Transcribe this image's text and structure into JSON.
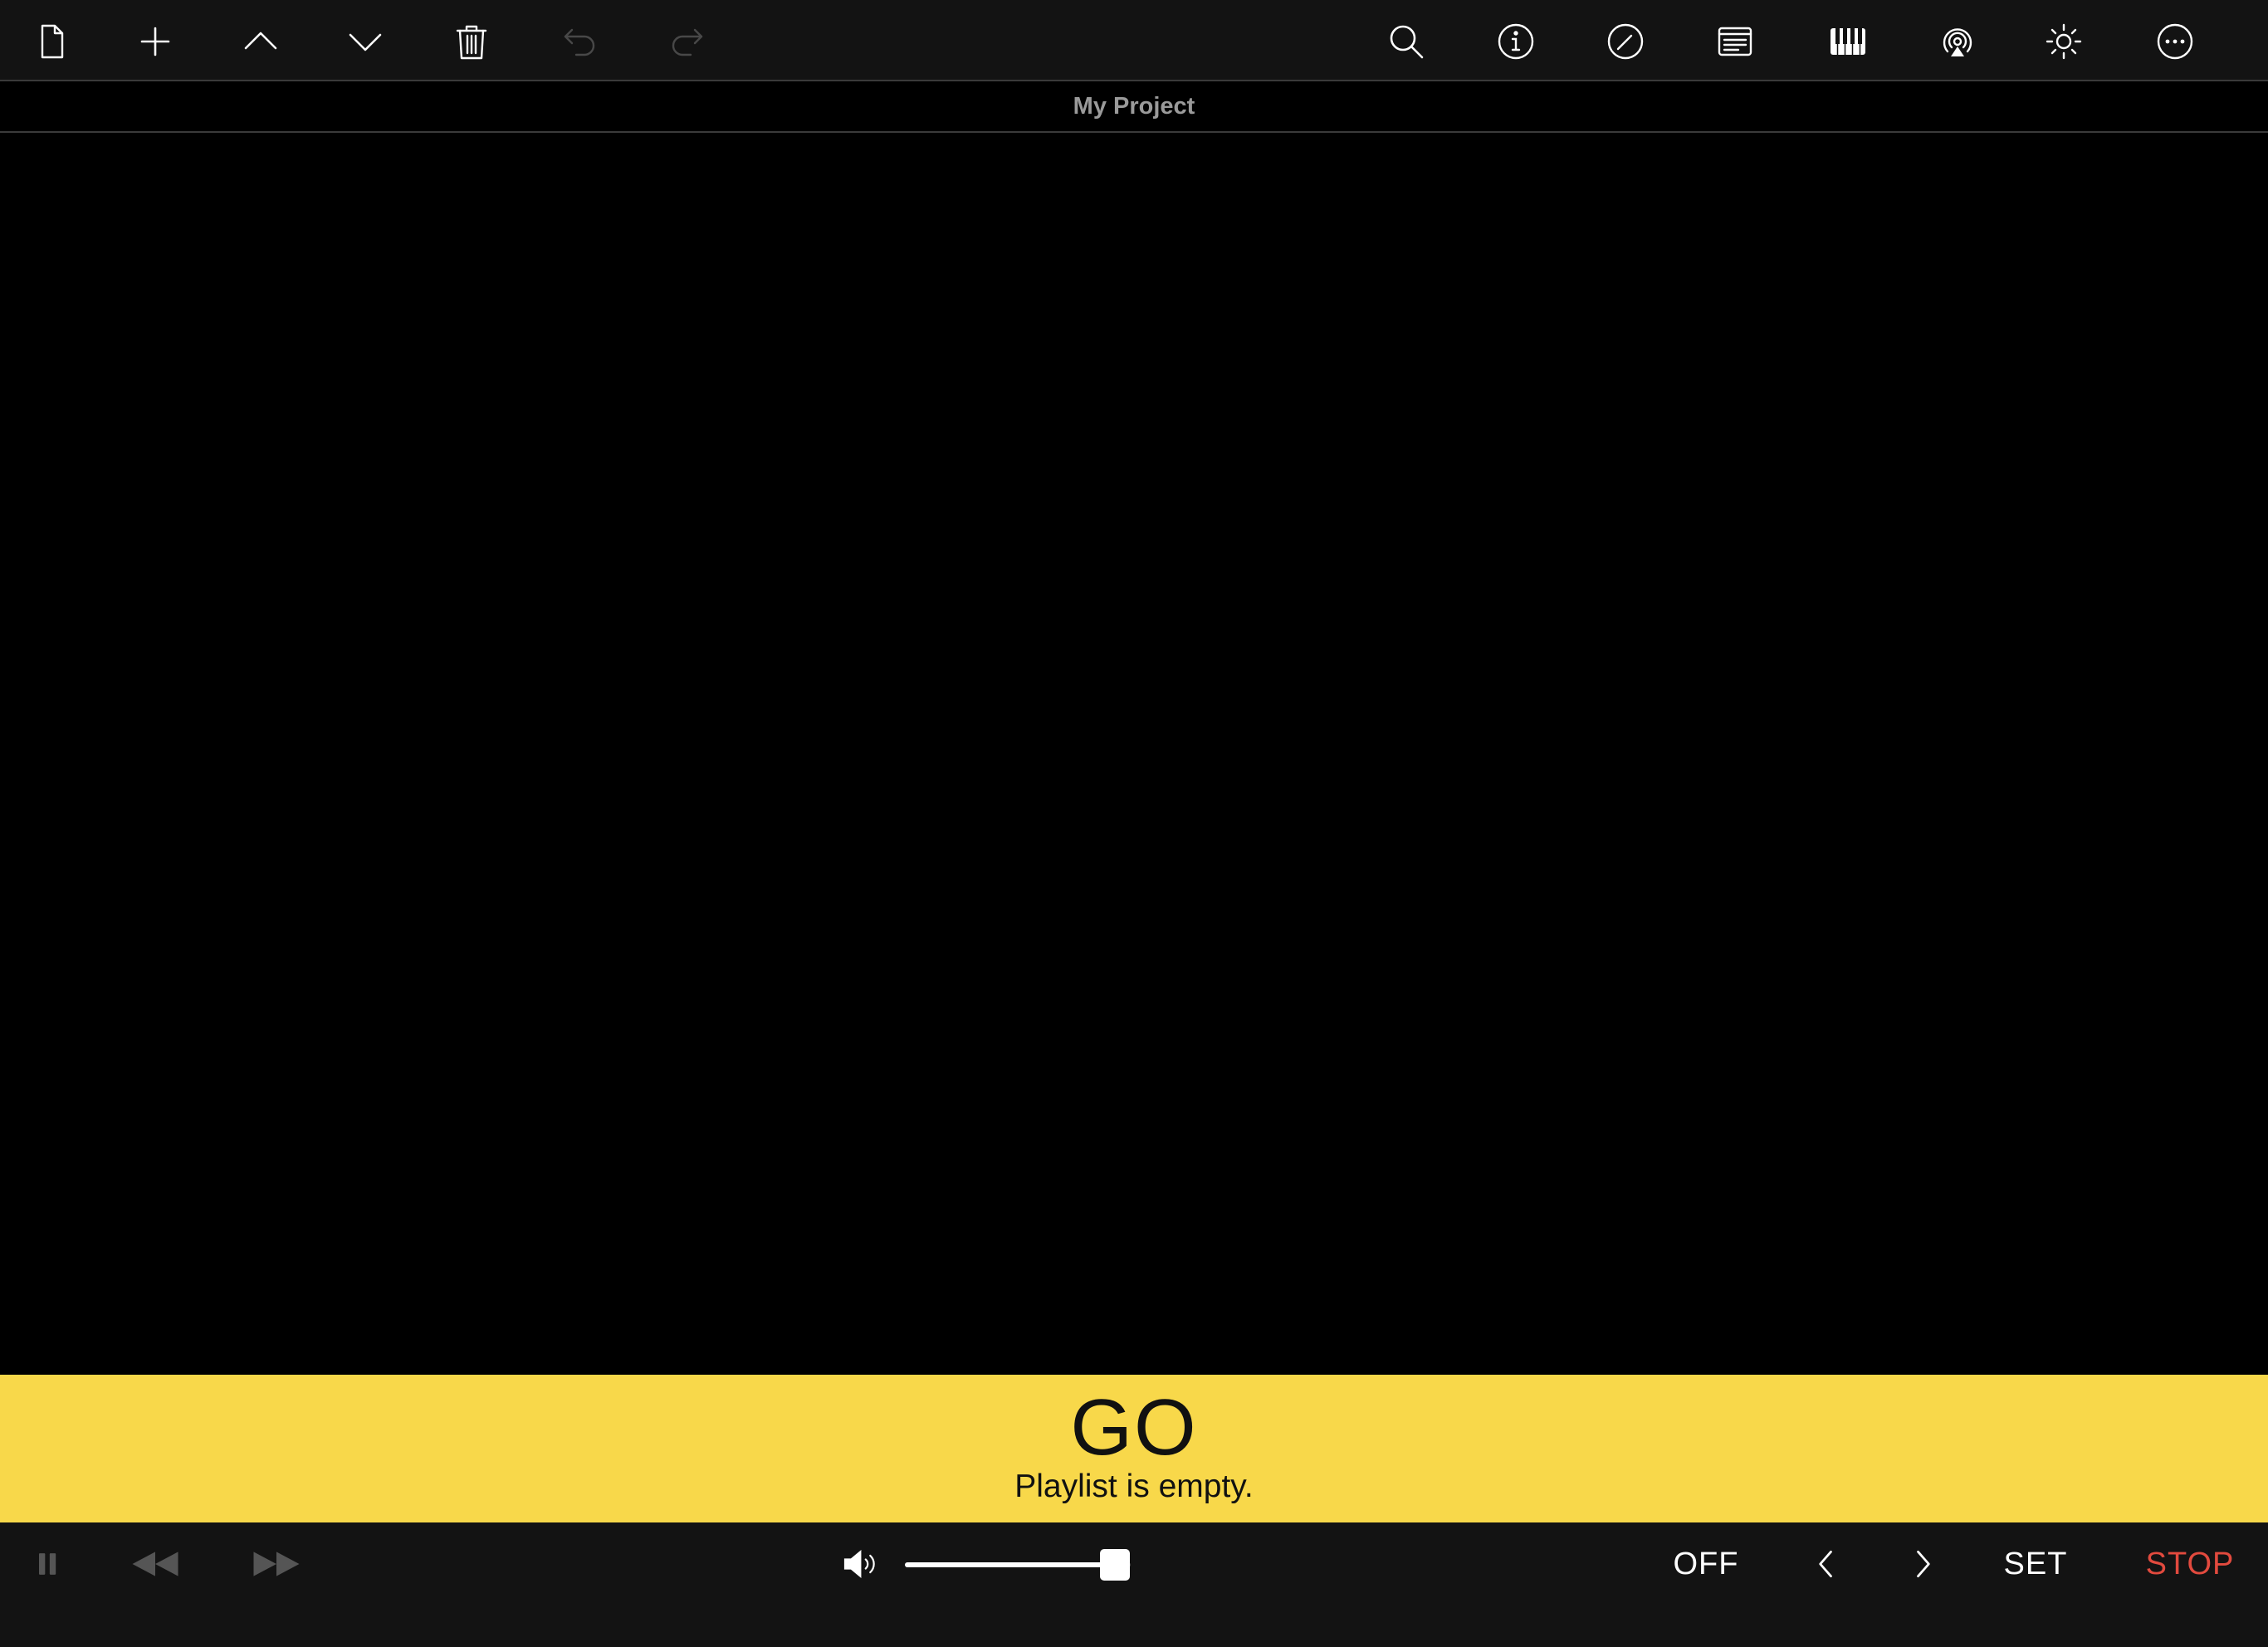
{
  "toolbar": {
    "left_icons": [
      "new-document-icon",
      "plus-icon",
      "chevron-up-icon",
      "chevron-down-icon",
      "trash-icon",
      "undo-icon",
      "redo-icon"
    ],
    "right_icons": [
      "search-icon",
      "info-icon",
      "edit-circle-icon",
      "text-panel-icon",
      "piano-keyboard-icon",
      "airplay-audio-icon",
      "brightness-icon",
      "more-icon"
    ]
  },
  "title": "My Project",
  "go": {
    "label": "GO",
    "subtitle": "Playlist is empty."
  },
  "transport": {
    "volume_level": 0.93,
    "off_label": "OFF",
    "set_label": "SET",
    "stop_label": "STOP",
    "stop_color": "#e24a3e"
  },
  "colors": {
    "go_bar": "#f8d84a",
    "toolbar_bg": "#131313",
    "main_bg": "#000000"
  }
}
